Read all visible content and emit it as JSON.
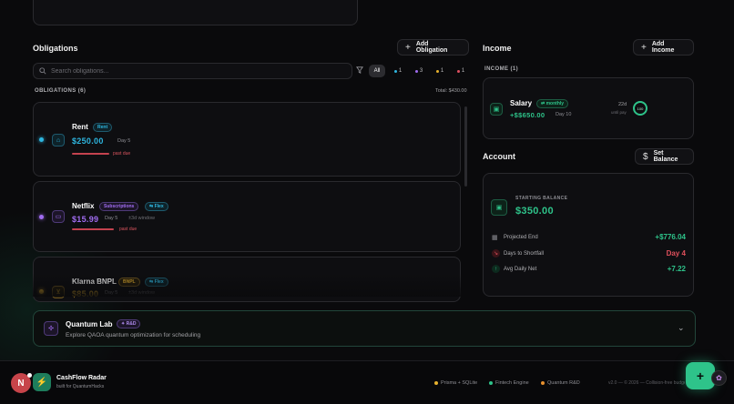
{
  "obligations": {
    "title": "Obligations",
    "add_label": "Add Obligation",
    "search_placeholder": "Search obligations...",
    "filters": [
      {
        "label": "All",
        "active": true
      },
      {
        "label": "1",
        "color": "#2eb6e0"
      },
      {
        "label": "3",
        "color": "#a06cf0"
      },
      {
        "label": "1",
        "color": "#e6b12e"
      },
      {
        "label": "1",
        "color": "#e05060"
      }
    ],
    "list_header": "OBLIGATIONS (6)",
    "total": "Total: $430.00",
    "items": [
      {
        "name": "Rent",
        "category": "Rent",
        "amount": "$250.00",
        "day": "Day 5",
        "status": "past due",
        "color": "#2eb6e0"
      },
      {
        "name": "Netflix",
        "category": "Subscriptions",
        "flex": "Flex",
        "amount": "$15.99",
        "day": "Day 5",
        "window": "±3d window",
        "status": "past due",
        "color": "#a06cf0"
      },
      {
        "name": "Klarna BNPL",
        "category": "BNPL",
        "flex": "Flex",
        "amount": "$85.00",
        "day": "Day 5",
        "window": "±3d window",
        "color": "#e6b12e"
      }
    ]
  },
  "income": {
    "title": "Income",
    "add_label": "Add Income",
    "list_header": "INCOME (1)",
    "items": [
      {
        "name": "Salary",
        "frequency": "monthly",
        "amount": "+$$650.00",
        "day": "Day 10",
        "days_left": "22d",
        "until": "until pay",
        "ring_label": "100"
      }
    ]
  },
  "account": {
    "title": "Account",
    "set_balance_label": "Set Balance",
    "starting_label": "STARTING BALANCE",
    "starting_value": "$350.00",
    "rows": [
      {
        "label": "Projected End",
        "value": "+$776.04",
        "color": "#2ec38a"
      },
      {
        "label": "Days to Shortfall",
        "value": "Day 4",
        "color": "#e0505c"
      },
      {
        "label": "Avg Daily Net",
        "value": "+7.22",
        "color": "#2ec38a"
      }
    ]
  },
  "quantum": {
    "title": "Quantum Lab",
    "badge": "R&D",
    "description": "Explore QAOA quantum optimization for scheduling"
  },
  "footer": {
    "avatar_letter": "N",
    "app_name": "CashFlow Radar",
    "tagline": "built for QuantumHacks",
    "links": [
      {
        "label": "Prisma + SQLite",
        "color": "#e6b12e"
      },
      {
        "label": "Fintech Engine",
        "color": "#2ec38a"
      },
      {
        "label": "Quantum R&D",
        "color": "#e6902e"
      }
    ],
    "copyright": "v2.0 — © 2026 — Collision-free budget"
  },
  "fab_label": "+"
}
